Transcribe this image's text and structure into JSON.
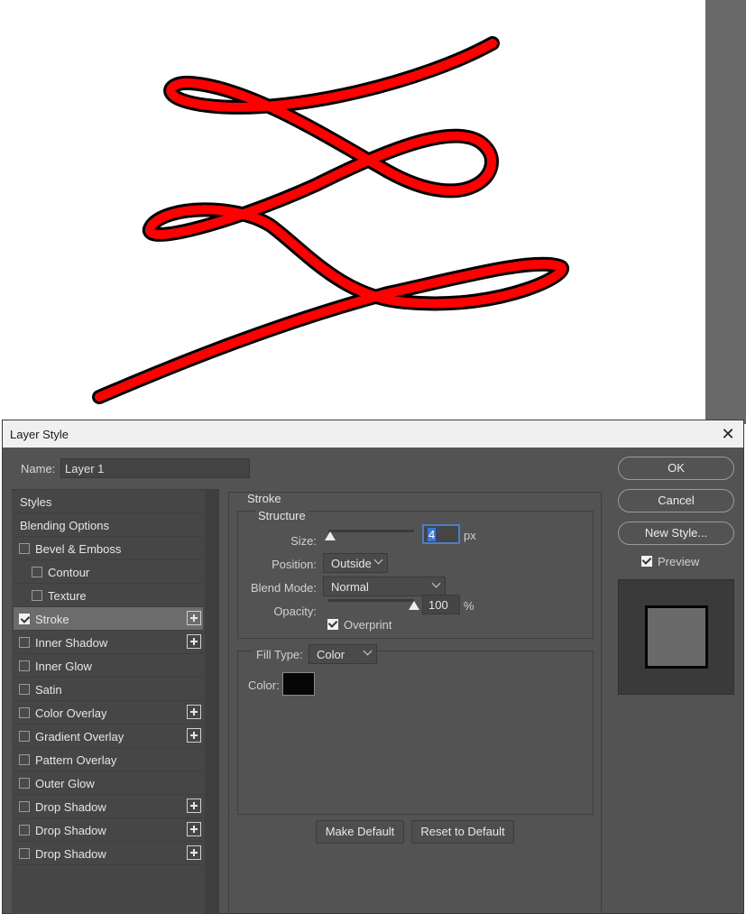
{
  "canvas": {
    "stroke_color": "#ff0000",
    "outline_color": "#000000",
    "background": "#ffffff"
  },
  "dialog": {
    "title": "Layer Style",
    "close_icon": "close-icon"
  },
  "name_field": {
    "label": "Name:",
    "value": "Layer 1"
  },
  "styles_list": [
    {
      "label": "Styles",
      "indent": 0,
      "checkbox": false,
      "checked": false,
      "plus": false,
      "active": false
    },
    {
      "label": "Blending Options",
      "indent": 0,
      "checkbox": false,
      "checked": false,
      "plus": false,
      "active": false
    },
    {
      "label": "Bevel & Emboss",
      "indent": 1,
      "checkbox": true,
      "checked": false,
      "plus": false,
      "active": false
    },
    {
      "label": "Contour",
      "indent": 2,
      "checkbox": true,
      "checked": false,
      "plus": false,
      "active": false
    },
    {
      "label": "Texture",
      "indent": 2,
      "checkbox": true,
      "checked": false,
      "plus": false,
      "active": false
    },
    {
      "label": "Stroke",
      "indent": 1,
      "checkbox": true,
      "checked": true,
      "plus": true,
      "active": true
    },
    {
      "label": "Inner Shadow",
      "indent": 1,
      "checkbox": true,
      "checked": false,
      "plus": true,
      "active": false
    },
    {
      "label": "Inner Glow",
      "indent": 1,
      "checkbox": true,
      "checked": false,
      "plus": false,
      "active": false
    },
    {
      "label": "Satin",
      "indent": 1,
      "checkbox": true,
      "checked": false,
      "plus": false,
      "active": false
    },
    {
      "label": "Color Overlay",
      "indent": 1,
      "checkbox": true,
      "checked": false,
      "plus": true,
      "active": false
    },
    {
      "label": "Gradient Overlay",
      "indent": 1,
      "checkbox": true,
      "checked": false,
      "plus": true,
      "active": false
    },
    {
      "label": "Pattern Overlay",
      "indent": 1,
      "checkbox": true,
      "checked": false,
      "plus": false,
      "active": false
    },
    {
      "label": "Outer Glow",
      "indent": 1,
      "checkbox": true,
      "checked": false,
      "plus": false,
      "active": false
    },
    {
      "label": "Drop Shadow",
      "indent": 1,
      "checkbox": true,
      "checked": false,
      "plus": true,
      "active": false
    },
    {
      "label": "Drop Shadow",
      "indent": 1,
      "checkbox": true,
      "checked": false,
      "plus": true,
      "active": false
    },
    {
      "label": "Drop Shadow",
      "indent": 1,
      "checkbox": true,
      "checked": false,
      "plus": true,
      "active": false
    }
  ],
  "stroke": {
    "section_title": "Stroke",
    "structure_title": "Structure",
    "size_label": "Size:",
    "size_value": "4",
    "size_unit": "px",
    "size_slider_fraction": 0.02,
    "position_label": "Position:",
    "position_value": "Outside",
    "blend_label": "Blend Mode:",
    "blend_value": "Normal",
    "opacity_label": "Opacity:",
    "opacity_value": "100",
    "opacity_unit": "%",
    "opacity_slider_fraction": 1.0,
    "overprint_label": "Overprint",
    "overprint_checked": true,
    "fill_type_label": "Fill Type:",
    "fill_type_value": "Color",
    "color_label": "Color:",
    "color_value": "#060606"
  },
  "buttons": {
    "make_default": "Make Default",
    "reset_default": "Reset to Default",
    "ok": "OK",
    "cancel": "Cancel",
    "new_style": "New Style...",
    "preview_label": "Preview",
    "preview_checked": true
  }
}
